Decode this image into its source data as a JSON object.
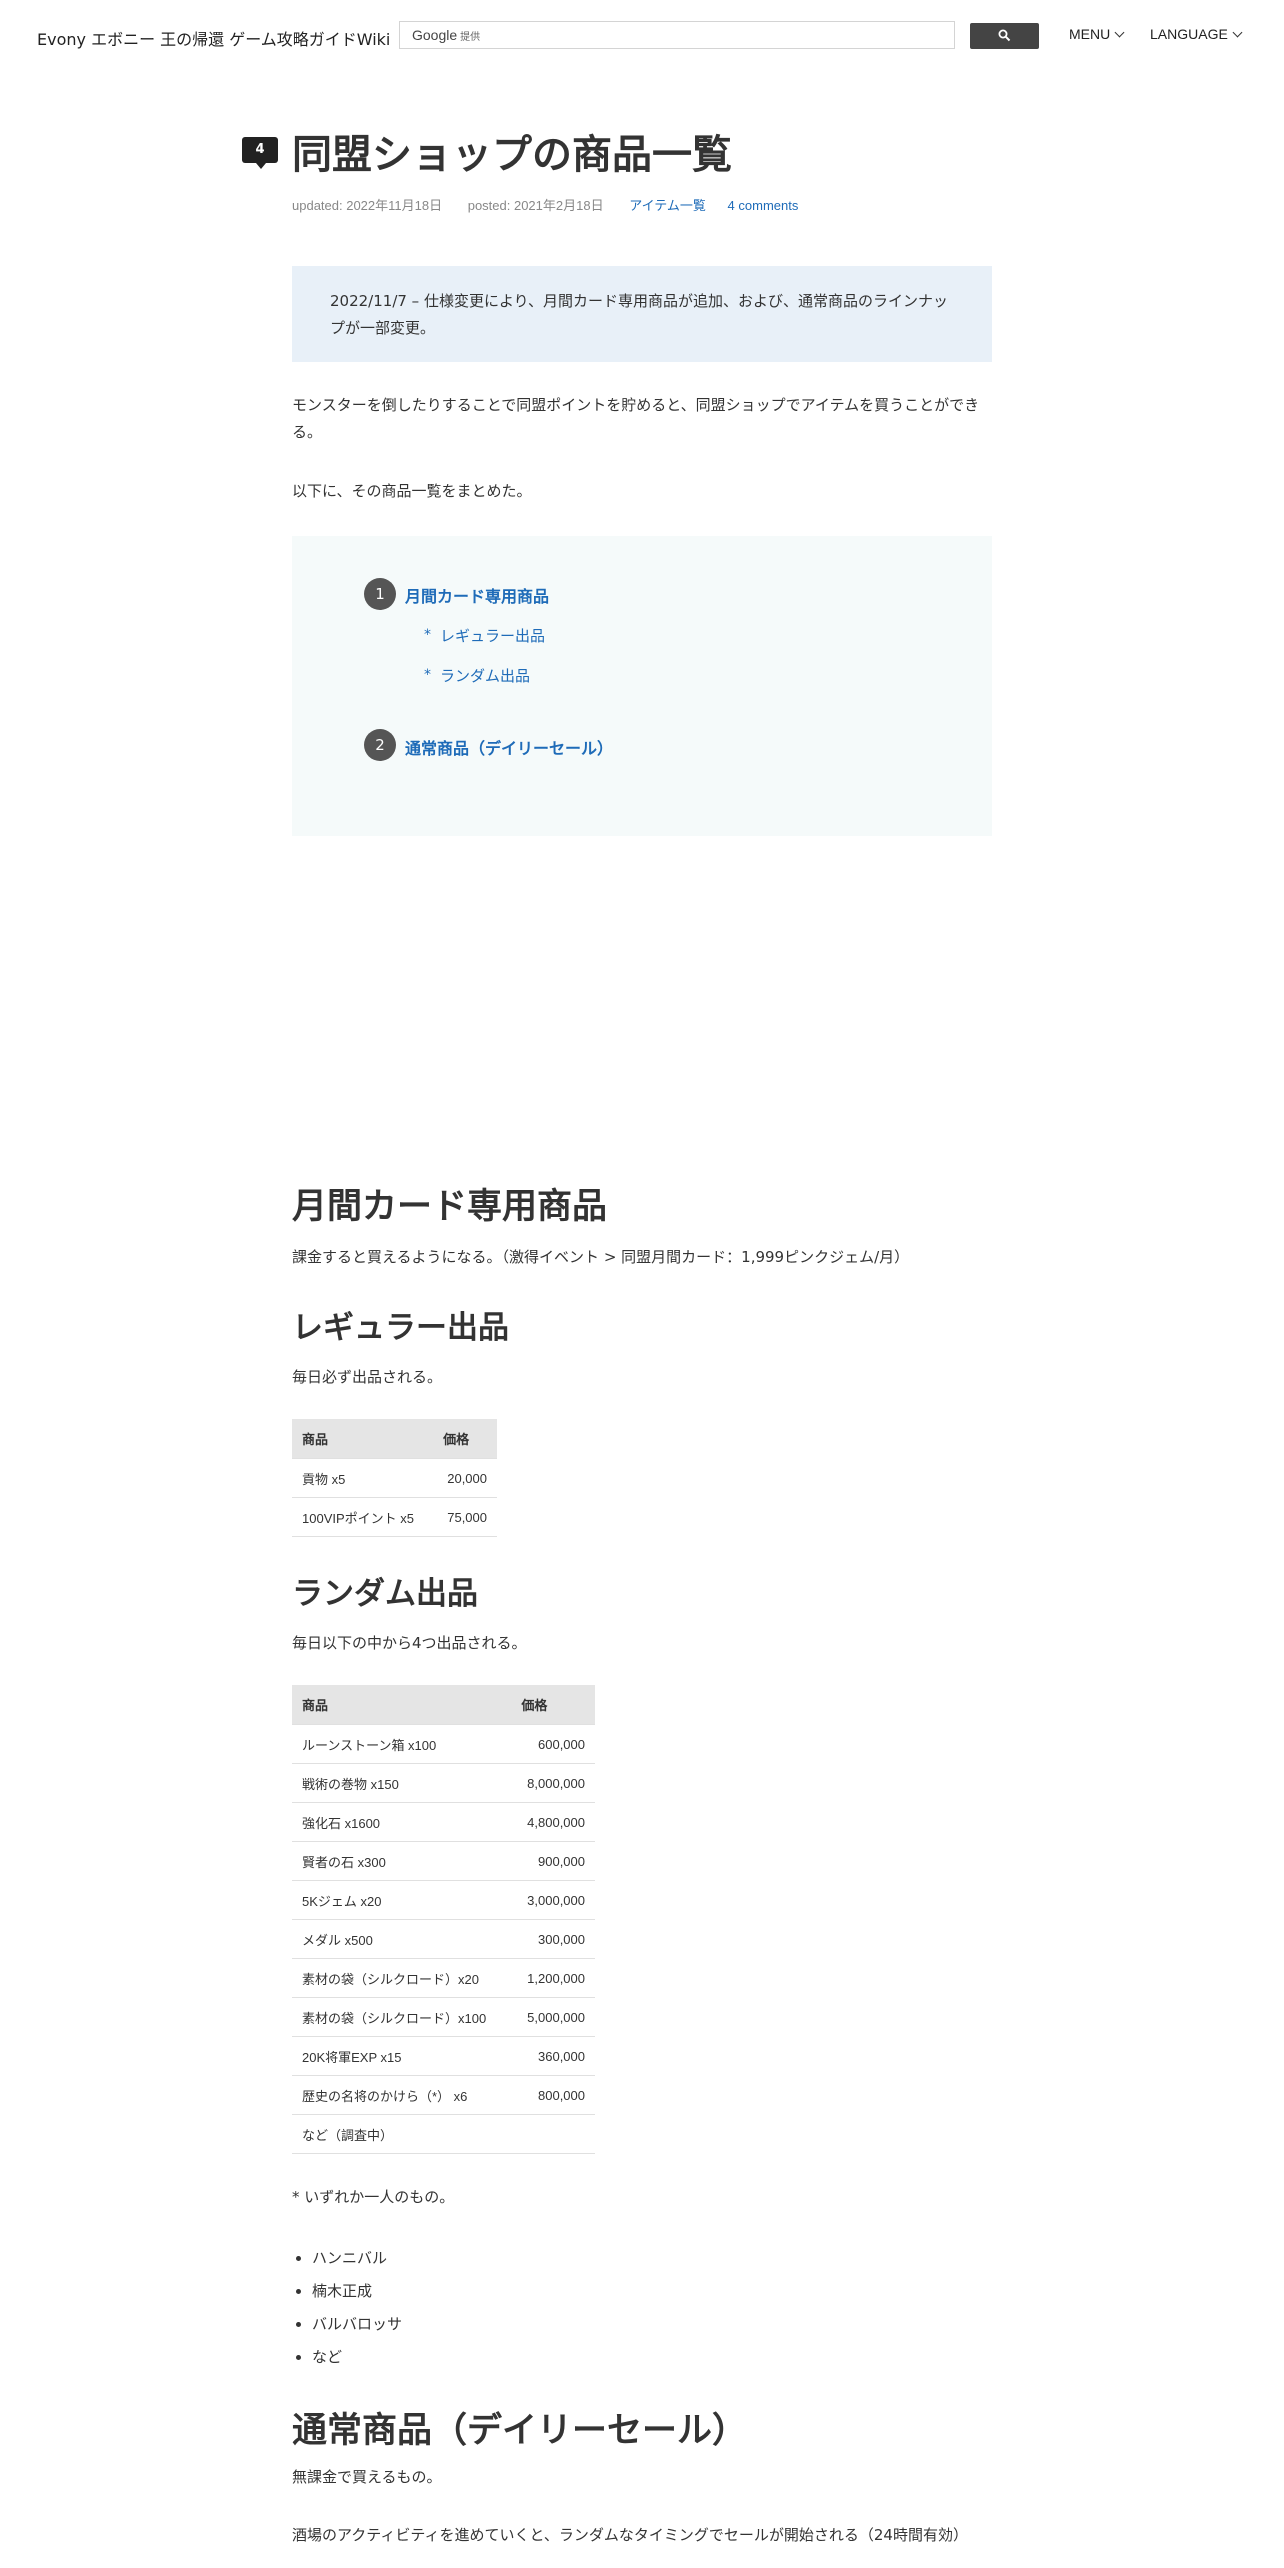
{
  "header": {
    "site_title": "Evony エボニー 王の帰還 ゲーム攻略ガイドWiki",
    "search_brand": "Google",
    "search_provided": "提供",
    "menu_label": "MENU",
    "language_label": "LANGUAGE"
  },
  "article": {
    "comment_count": "4",
    "title": "同盟ショップの商品一覧",
    "updated": "updated: 2022年11月18日",
    "posted": "posted: 2021年2月18日",
    "category": "アイテム一覧",
    "comments_link": "4 comments",
    "notice": "2022/11/7 – 仕様変更により、月間カード専用商品が追加、および、通常商品のラインナップが一部変更。",
    "intro_1": "モンスターを倒したりすることで同盟ポイントを貯めると、同盟ショップでアイテムを買うことができる。",
    "intro_2": "以下に、その商品一覧をまとめた。"
  },
  "toc": {
    "items": [
      {
        "num": "1",
        "label": "月間カード専用商品",
        "children": [
          "レギュラー出品",
          "ランダム出品"
        ]
      },
      {
        "num": "2",
        "label": "通常商品（デイリーセール）",
        "children": []
      }
    ],
    "bullet": "*"
  },
  "monthly": {
    "heading": "月間カード専用商品",
    "desc": "課金すると買えるようになる。（激得イベント > 同盟月間カード：1,999ピンクジェム/月）"
  },
  "regular": {
    "heading": "レギュラー出品",
    "desc": "毎日必ず出品される。",
    "columns": [
      "商品",
      "価格"
    ],
    "rows": [
      [
        "貢物 x5",
        "20,000"
      ],
      [
        "100VIPポイント x5",
        "75,000"
      ]
    ]
  },
  "random": {
    "heading": "ランダム出品",
    "desc": "毎日以下の中から4つ出品される。",
    "columns": [
      "商品",
      "価格"
    ],
    "rows": [
      [
        "ルーンストーン箱 x100",
        "600,000"
      ],
      [
        "戦術の巻物 x150",
        "8,000,000"
      ],
      [
        "強化石 x1600",
        "4,800,000"
      ],
      [
        "賢者の石 x300",
        "900,000"
      ],
      [
        "5Kジェム x20",
        "3,000,000"
      ],
      [
        "メダル x500",
        "300,000"
      ],
      [
        "素材の袋（シルクロード）x20",
        "1,200,000"
      ],
      [
        "素材の袋（シルクロード）x100",
        "5,000,000"
      ],
      [
        "20K将軍EXP x15",
        "360,000"
      ],
      [
        "歴史の名将のかけら（*） x6",
        "800,000"
      ],
      [
        "など（調査中）",
        ""
      ]
    ],
    "footnote": "* いずれか一人のもの。",
    "generals": [
      "ハンニバル",
      "楠木正成",
      "バルバロッサ",
      "など"
    ]
  },
  "daily": {
    "heading": "通常商品（デイリーセール）",
    "desc": "無課金で買えるもの。",
    "desc_2": "酒場のアクティビティを進めていくと、ランダムなタイミングでセールが開始される（24時間有効）"
  }
}
